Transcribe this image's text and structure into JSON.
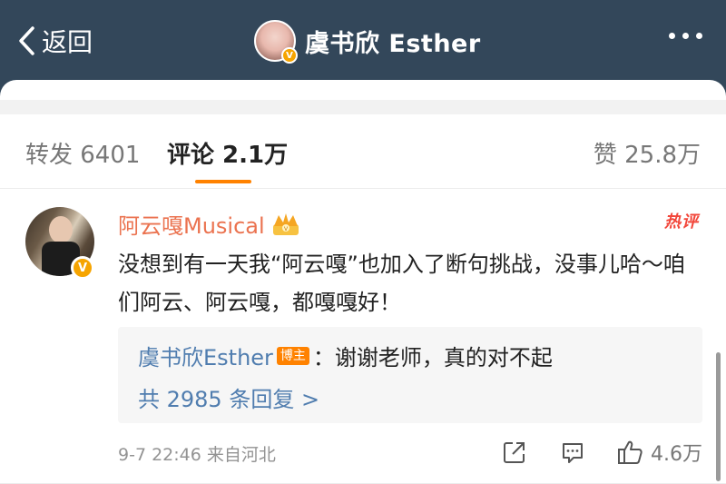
{
  "header": {
    "back_label": "返回",
    "title": "虞书欣 Esther",
    "avatar_badge": "V"
  },
  "tabs": {
    "repost": "转发 6401",
    "comment": "评论 2.1万",
    "like": "赞 25.8万",
    "active": "comment",
    "accent_color": "#ff8200"
  },
  "comment": {
    "author": "阿云嘎Musical",
    "avatar_badge": "V",
    "hot_label": "热评",
    "text": "没想到有一天我“阿云嘎”也加入了断句挑战，没事儿哈～咱们阿云、阿云嘎，都嘎嘎好！",
    "reply": {
      "author": "虞书欣Esther",
      "poster_badge": "博主",
      "text": "：谢谢老师，真的对不起",
      "more": "共 2985 条回复 >"
    },
    "meta": "9-7 22:46  来自河北",
    "like_count": "4.6万",
    "icons": [
      "share-icon",
      "comment-icon",
      "like-icon",
      "crown-icon"
    ]
  },
  "colors": {
    "header_bg": "#33475a",
    "name_color": "#eb7350",
    "link_color": "#507daf"
  }
}
